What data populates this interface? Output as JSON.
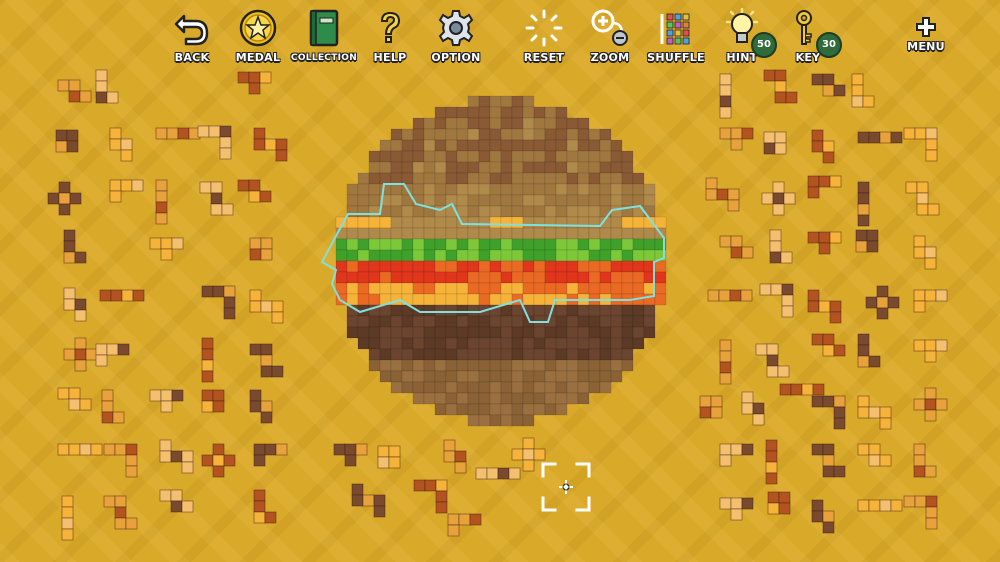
{
  "toolbar": {
    "back": "BACK",
    "medal": "MEDAL",
    "collection": "COLLECTION",
    "help": "HELP",
    "option": "OPTION",
    "reset": "RESET",
    "zoom": "ZOOM",
    "shuffle": "SHUFFLE",
    "hint": "HINT",
    "hint_count": "50",
    "key": "KEY",
    "key_count": "30",
    "menu": "MENU"
  },
  "puzzle": {
    "subject": "hamburger",
    "grid_columns": 30,
    "grid_rows": 30,
    "active_piece": "lettuce-tomato-layer"
  },
  "colors": {
    "background": "#d9a92a",
    "bun_top": "#8a5a35",
    "bun_top_light": "#a0783f",
    "bun_edge": "#b08a4a",
    "lettuce": "#3fa02a",
    "lettuce_light": "#7cc839",
    "tomato": "#e0361c",
    "tomato_orange": "#ea6a24",
    "cheese": "#f6b33a",
    "patty": "#5c3a26",
    "bun_bottom": "#8a6236",
    "piece_orange": "#e8a23c",
    "piece_light": "#f4c070",
    "piece_dark": "#b35420",
    "piece_brown": "#7a4a2e",
    "highlight_outline": "#7fe0e0"
  }
}
